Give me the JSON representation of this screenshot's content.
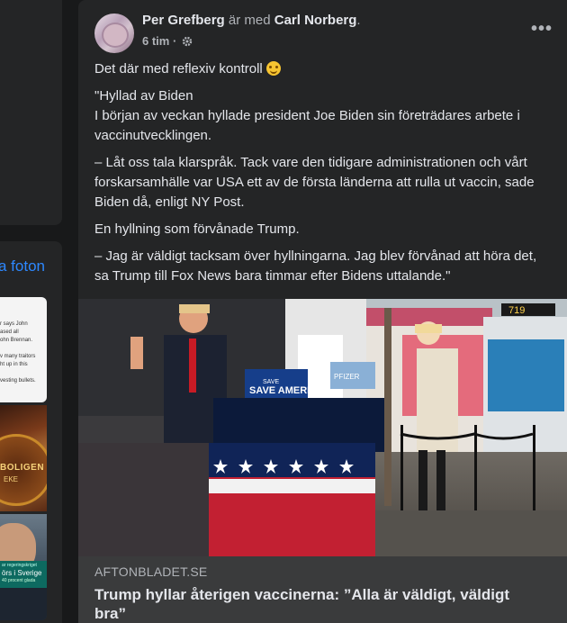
{
  "sidebar": {
    "photos_link": "a foton",
    "thumbnails": [
      {
        "lines": [
          "r says John",
          "ased all",
          "ohn Brennan.",
          "",
          "v many traitors",
          "ht up in this",
          "",
          "vesting bullets."
        ]
      },
      {
        "text": "BOLIGEN",
        "subtext": "EKE"
      },
      {
        "small1": "ar regeringskriget",
        "caption": "örs i Sverige",
        "small2": "40 procent glada"
      }
    ]
  },
  "post": {
    "author": "Per Grefberg",
    "with_text": "är med",
    "tagged": "Carl Norberg",
    "tagged_suffix": ".",
    "time": "6 tim",
    "time_sep": " · ",
    "more_label": "•••",
    "paragraphs": [
      "Det där med reflexiv kontroll",
      "\"Hyllad av Biden",
      "I början av veckan hyllade president Joe Biden sin företrädares arbete i vaccinutvecklingen.",
      "– Låt oss tala klarspråk. Tack vare den tidigare administrationen och vårt forskarsamhälle var USA ett av de första länderna att rulla ut vaccin, sade Biden då, enligt NY Post.",
      "En hyllning som förvånade Trump.",
      "– Jag är väldigt tacksam över hyllningarna. Jag blev förvånad att höra det, sa Trump till Fox News bara timmar efter Bidens uttalande.\""
    ],
    "image_text": {
      "podium": "SAVE AMERICA",
      "sign": "PFIZER",
      "bus_number": "719"
    },
    "link": {
      "domain": "AFTONBLADET.SE",
      "headline": "Trump hyllar återigen vaccinerna: ”Alla är väldigt, väldigt bra”"
    }
  },
  "colors": {
    "background": "#18191a",
    "card": "#242526",
    "link_card": "#3a3b3c",
    "accent_link": "#2d88ff",
    "text_primary": "#e4e6eb",
    "text_secondary": "#b0b3b8"
  },
  "icons": {
    "privacy": "gear-icon",
    "emoji": "winking-face-icon",
    "more": "more-options-icon"
  }
}
